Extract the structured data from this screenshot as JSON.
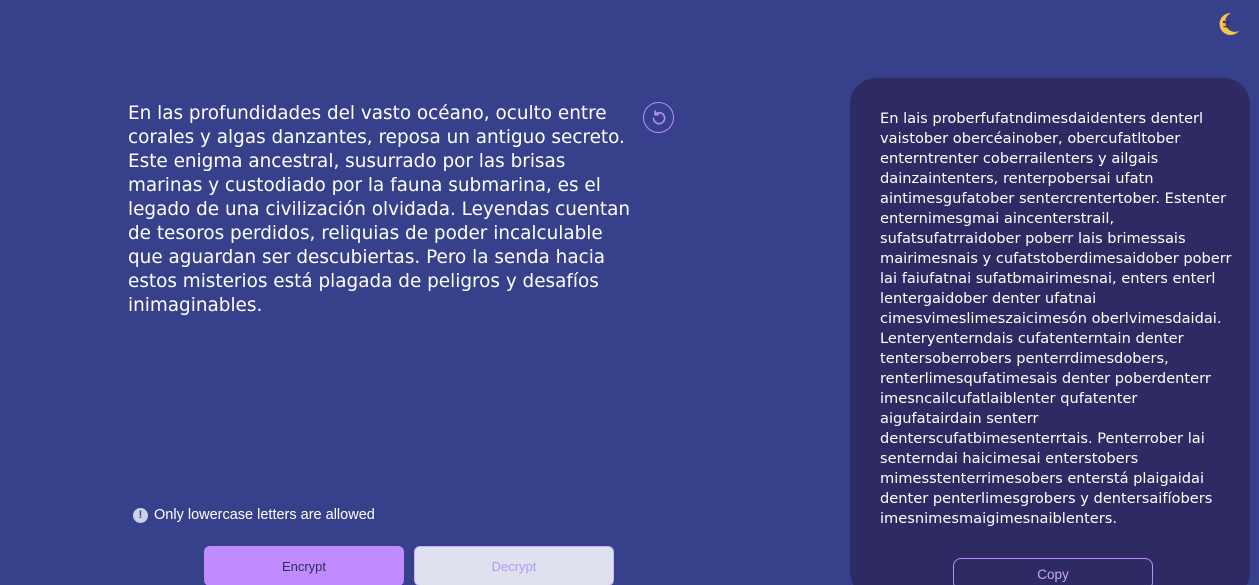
{
  "theme": {
    "toggle_icon": "moon-icon",
    "accent_color": "#c08bff",
    "background_color": "#37418b",
    "panel_color": "#2e2a63"
  },
  "input": {
    "text": "En las profundidades del vasto océano, oculto entre corales y algas danzantes, reposa un antiguo secreto. Este enigma ancestral, susurrado por las brisas marinas y custodiado por la fauna submarina, es el legado de una civilización olvidada. Leyendas cuentan de tesoros perdidos, reliquias de poder incalculable que aguardan ser descubiertas. Pero la senda hacia estos misterios está plagada de peligros y desafíos inimaginables.",
    "reset_icon": "reset-icon"
  },
  "warning": {
    "icon": "info-icon",
    "icon_glyph": "!",
    "text": "Only lowercase letters are allowed"
  },
  "actions": {
    "encrypt_label": "Encrypt",
    "decrypt_label": "Decrypt"
  },
  "output": {
    "text": "En lais proberfufatndimesdaidenters denterl vaistober obercéainober, obercufatltober enterntrenter coberrailenters y ailgais dainzaintenters, renterpobersai ufatn aintimesgufatober sentercrentertober. Estenter enternimesgmai aincenterstrail, sufatsufatrraidober poberr lais brimessais mairimesnais y cufatstoberdimesaidober poberr lai faiufatnai sufatbmairimesnai, enters enterl lentergaidober denter ufatnai cimesvimeslimeszaicimesón oberlvimesdaidai. Lenteryenterndais cufatenterntain denter tentersoberrobers penterrdimesdobers, renterlimesqufatimesais denter poberdenterr imesncailcufatlaiblenter qufatenter aigufatairdain senterr denterscufatbimesenterrtais. Penterrober lai senterndai haicimesai enterstobers mimesstenterrimesobers enterstá plaigaidai denter penterlimesgrobers y dentersaifíobers imesnimesmaigimesnaiblenters.",
    "copy_label": "Copy"
  }
}
